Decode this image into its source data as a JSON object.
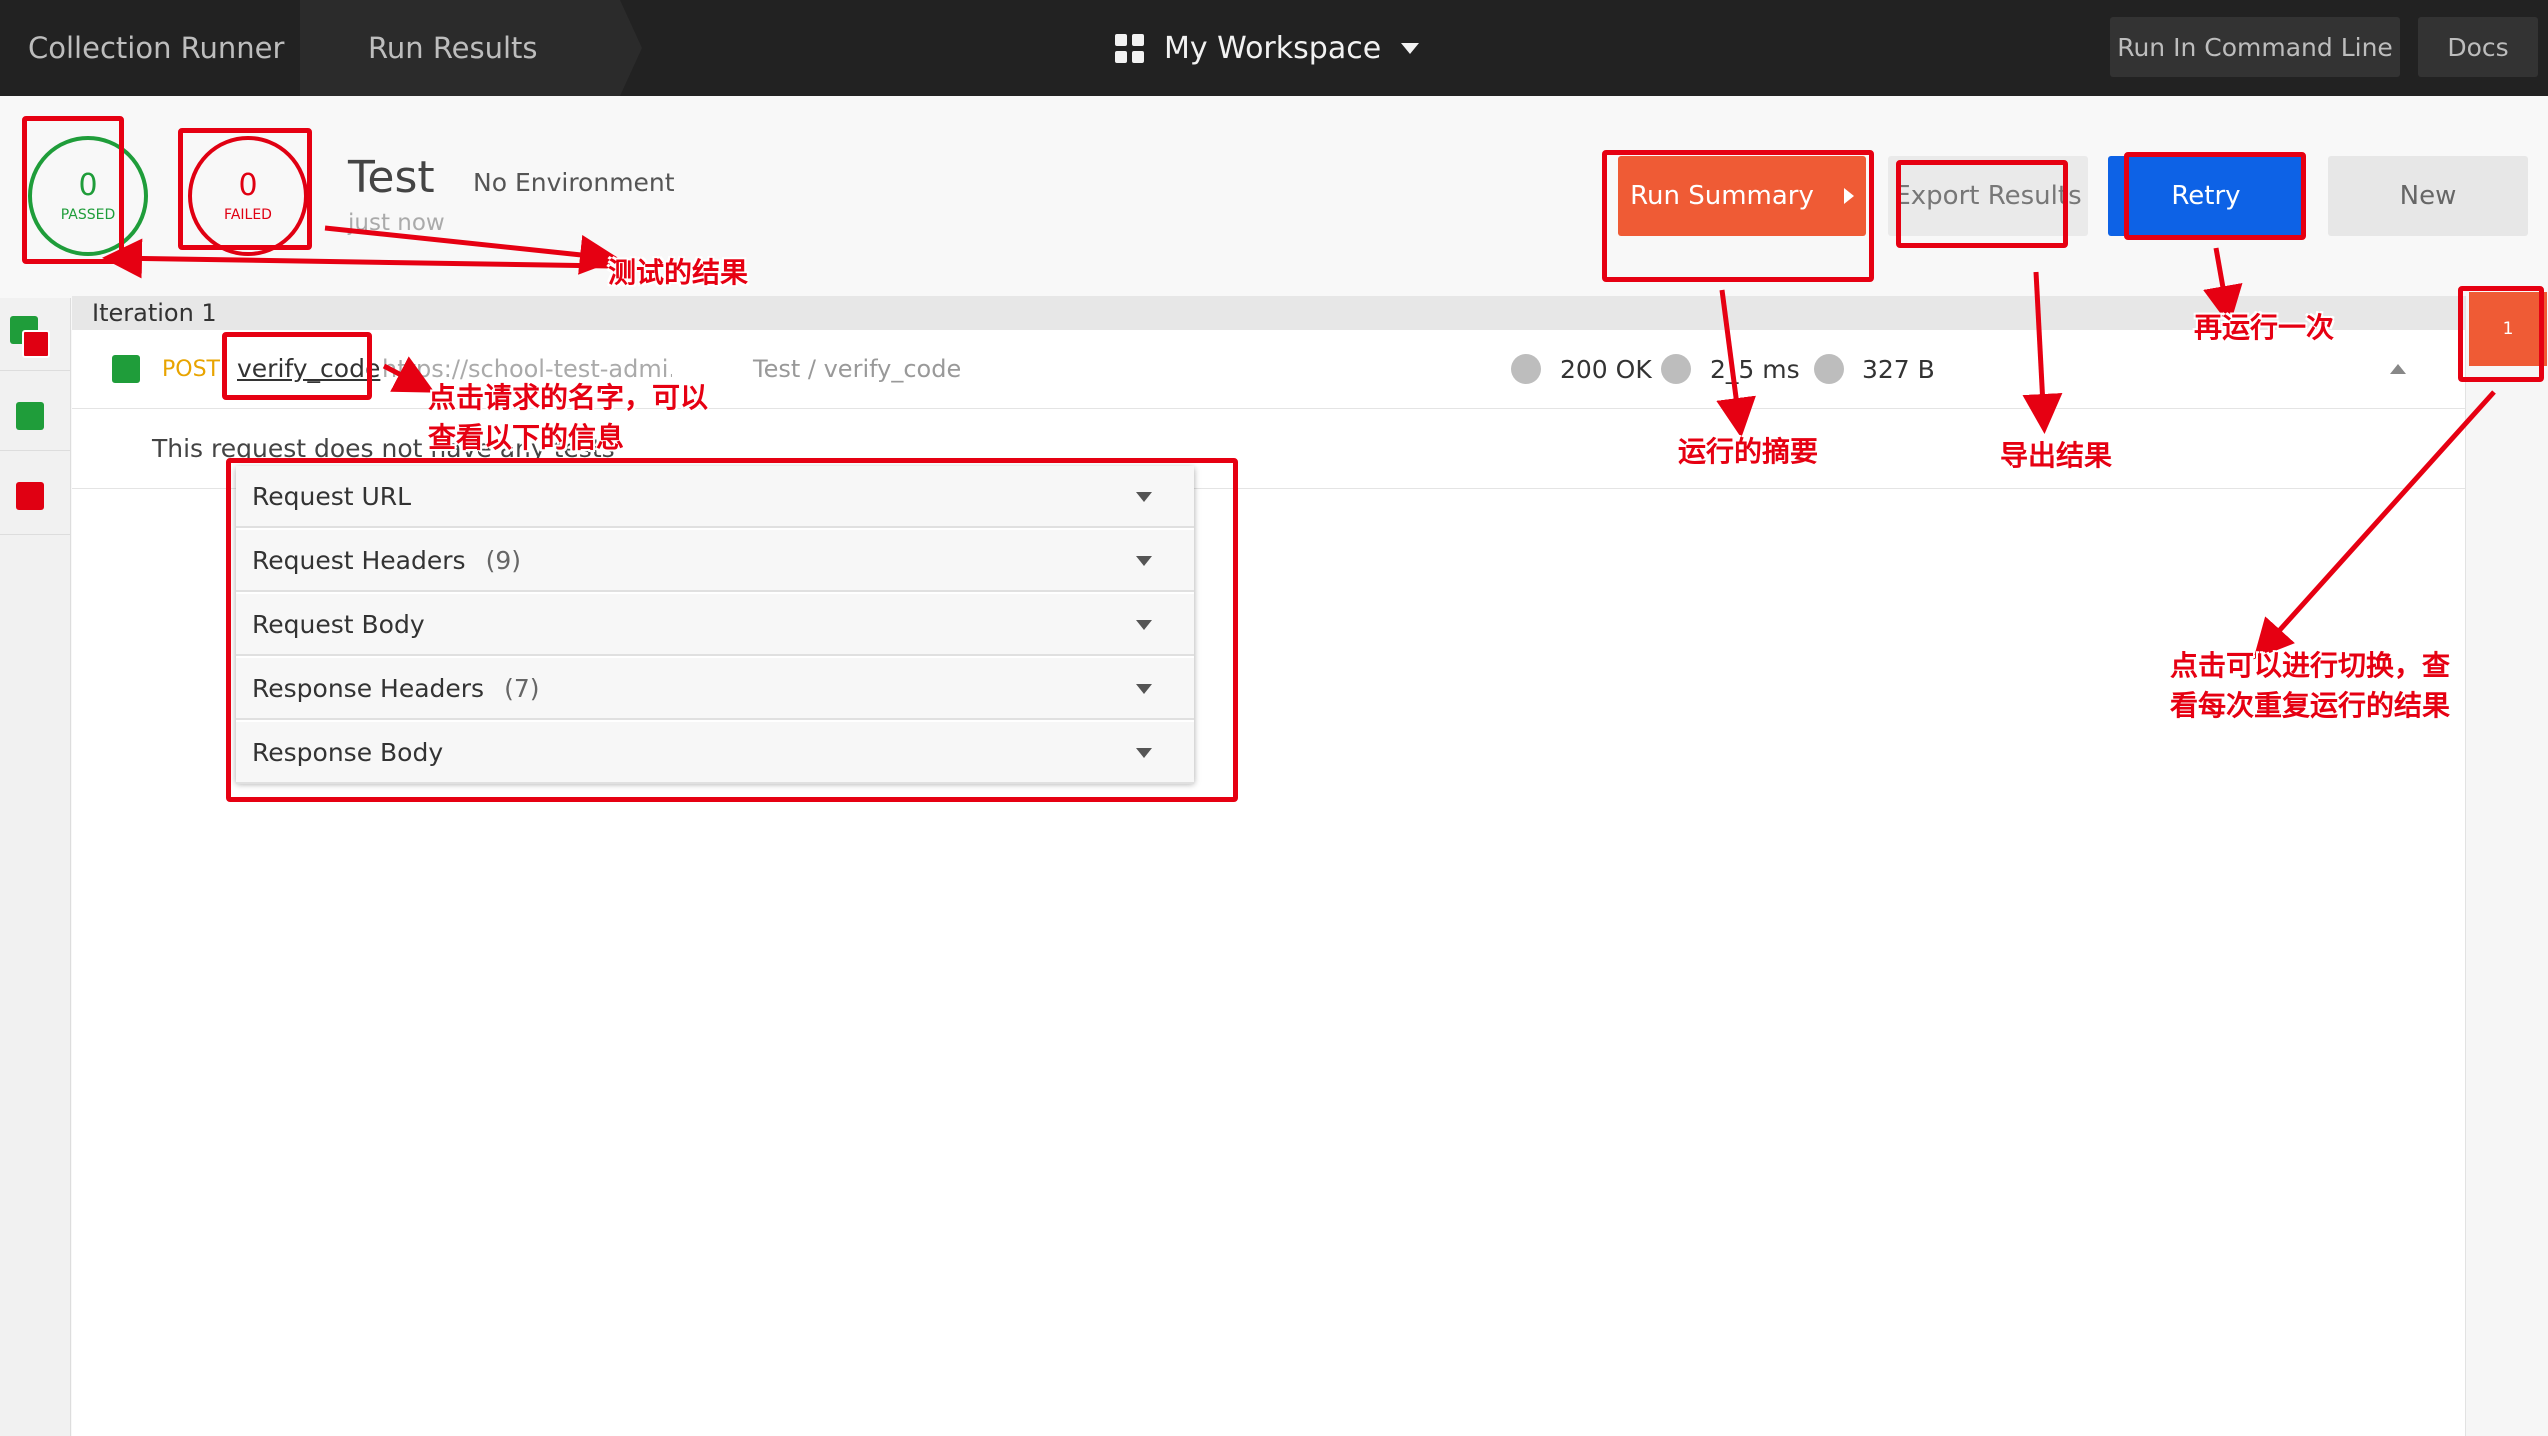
{
  "topbar": {
    "tab_runner": "Collection Runner",
    "tab_results": "Run Results",
    "workspace": "My Workspace",
    "run_cli": "Run In Command Line",
    "docs": "Docs"
  },
  "summary": {
    "passed_count": "0",
    "passed_label": "PASSED",
    "failed_count": "0",
    "failed_label": "FAILED",
    "collection": "Test",
    "environment": "No Environment",
    "time": "just now"
  },
  "actions": {
    "run_summary": "Run Summary",
    "export": "Export Results",
    "retry": "Retry",
    "new": "New"
  },
  "iteration": {
    "label": "Iteration 1",
    "tab_number": "1"
  },
  "request": {
    "method": "POST",
    "name": "verify_code",
    "url": "https://school-test-admi...",
    "path": "Test / verify_code",
    "status": "200 OK",
    "time": "2_5 ms",
    "size": "327 B",
    "notice": "This request does not have any tests"
  },
  "accordion": [
    {
      "label": "Request URL",
      "count": ""
    },
    {
      "label": "Request Headers",
      "count": "(9)"
    },
    {
      "label": "Request Body",
      "count": ""
    },
    {
      "label": "Response Headers",
      "count": "(7)"
    },
    {
      "label": "Response Body",
      "count": ""
    }
  ],
  "annotations": {
    "results": "测试的结果",
    "click_name_1": "点击请求的名字，可以",
    "click_name_2": "查看以下的信息",
    "run_summary": "运行的摘要",
    "export": "导出结果",
    "retry": "再运行一次",
    "switch_1": "点击可以进行切换，查",
    "switch_2": "看每次重复运行的结果"
  },
  "colors": {
    "pass": "#1f9d3a",
    "fail": "#e00012",
    "accent_orange": "#ef5b35",
    "retry_blue": "#0d62e6",
    "annotation_red": "#e60012"
  }
}
